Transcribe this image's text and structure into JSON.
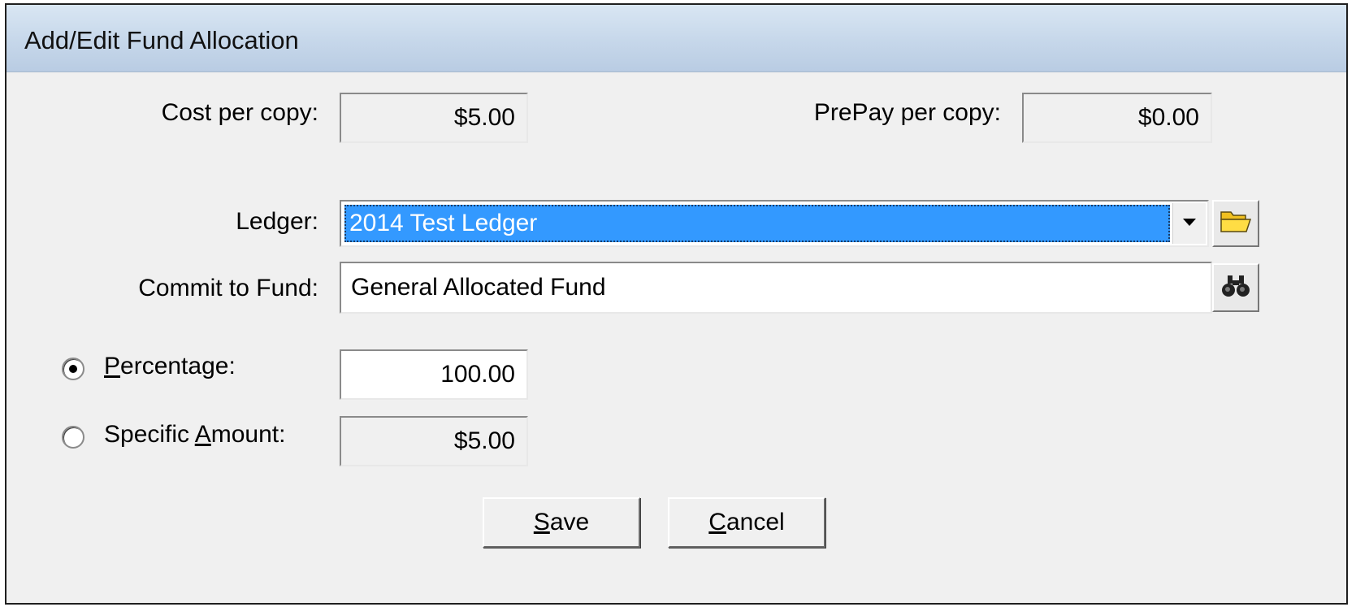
{
  "window": {
    "title": "Add/Edit Fund Allocation"
  },
  "cost_per_copy": {
    "label": "Cost per copy:",
    "value": "$5.00"
  },
  "prepay_per_copy": {
    "label": "PrePay per copy:",
    "value": "$0.00"
  },
  "ledger": {
    "label": "Ledger:",
    "selected": "2014 Test Ledger",
    "dropdown_icon": "chevron-down-icon",
    "browse_icon": "folder-open-icon"
  },
  "commit_to_fund": {
    "label": "Commit to Fund:",
    "value": "General Allocated Fund",
    "search_icon": "binoculars-icon"
  },
  "allocation": {
    "percentage": {
      "label_mnemonic": "P",
      "label_rest": "ercentage:",
      "value": "100.00",
      "selected": true
    },
    "specific_amount": {
      "label_before": "Specific ",
      "label_mnemonic": "A",
      "label_after": "mount:",
      "value": "$5.00",
      "selected": false
    }
  },
  "buttons": {
    "save": {
      "mnemonic": "S",
      "rest": "ave"
    },
    "cancel": {
      "mnemonic": "C",
      "rest": "ancel"
    }
  },
  "colors": {
    "selection": "#3399ff",
    "title_bar": "#c6d7ea",
    "dialog_bg": "#f0f0f0"
  }
}
